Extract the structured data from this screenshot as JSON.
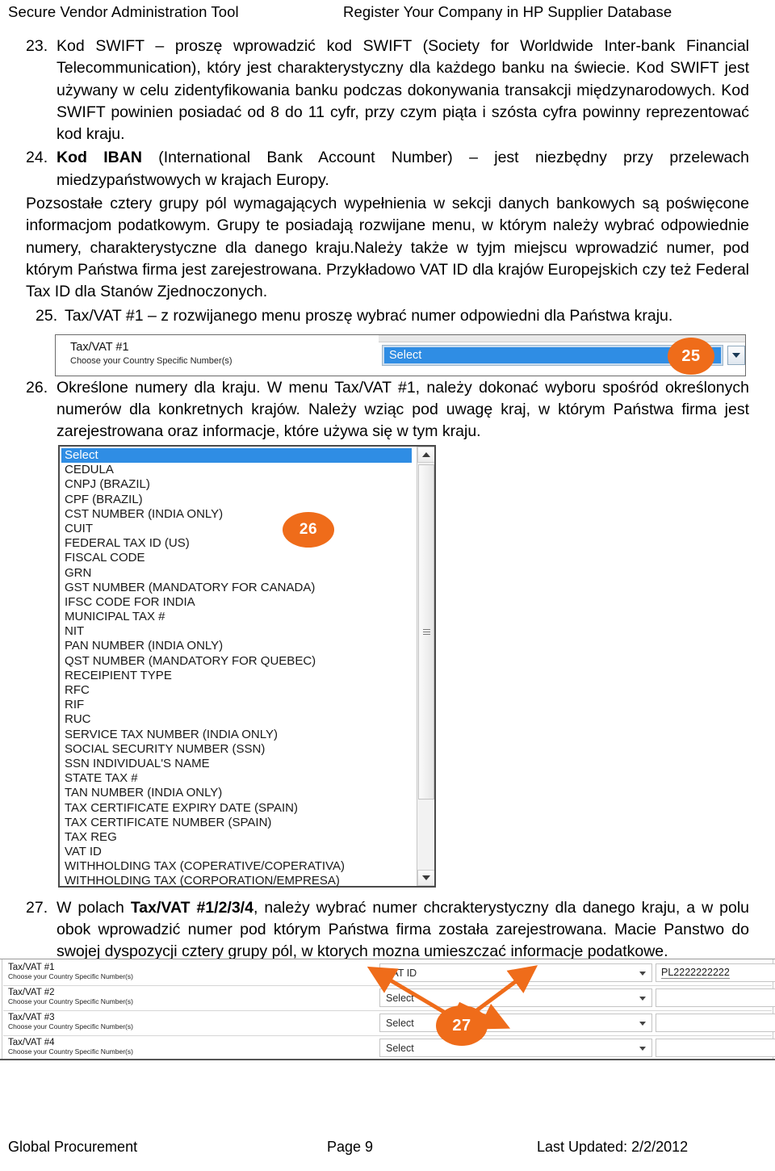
{
  "header": {
    "left": "Secure Vendor Administration Tool",
    "right": "Register Your Company in HP Supplier Database"
  },
  "items": {
    "i23": {
      "num": "23.",
      "text": "Kod SWIFT – proszę wprowadzić kod SWIFT (Society for Worldwide Inter-bank Financial Telecommunication), który jest charakterystyczny dla każdego banku na świecie. Kod SWIFT jest używany w celu zidentyfikowania banku podczas dokonywania transakcji międzynarodowych. Kod SWIFT powinien posiadać od 8 do 11 cyfr, przy czym piąta i szósta cyfra powinny reprezentować kod kraju."
    },
    "i24": {
      "num": "24.",
      "bold": "Kod IBAN",
      "text": " (International Bank Account Number) – jest niezbędny przy przelewach miedzypaństwowych w krajach Europy."
    },
    "p_after_24": "Pozsostałe cztery grupy pól wymagających wypełnienia w sekcji danych bankowych są poświęcone informacjom podatkowym. Grupy te posiadają rozwijane menu, w którym należy wybrać odpowiednie numery, charakterystyczne dla danego kraju.Należy także w tyjm miejscu wprowadzić numer, pod którym Państwa firma jest zarejestrowana. Przykładowo VAT ID dla krajów Europejskich czy też Federal Tax ID dla Stanów Zjednoczonych.",
    "i25": {
      "num": "25.",
      "text": "Tax/VAT #1 – z rozwijanego menu proszę wybrać numer odpowiedni dla Państwa kraju."
    },
    "i26": {
      "num": "26.",
      "text": "Określone numery dla kraju. W menu Tax/VAT #1, należy dokonać wyboru spośród określonych numerów dla konkretnych krajów. Należy wziąc pod uwagę kraj, w którym Państwa firma jest zarejestrowana oraz informacje, które używa się w tym kraju."
    },
    "i27": {
      "num": "27.",
      "pre": "W polach ",
      "bold": "Tax/VAT #1/2/3/4",
      "post": ", należy wybrać numer chcrakterystyczny dla danego kraju, a w polu obok wprowadzić numer pod którym Państwa firma została zarejestrowana. Macie Panstwo do swojej dyspozycji cztery grupy pól, w ktorych mozna umieszczać informacje podatkowe."
    }
  },
  "figure25": {
    "field_label": "Tax/VAT #1",
    "field_sublabel": "Choose your Country Specific Number(s)",
    "select_value": "Select",
    "badge": "25"
  },
  "figure26": {
    "badge": "26",
    "options": [
      "Select",
      "CEDULA",
      "CNPJ (BRAZIL)",
      "CPF (BRAZIL)",
      "CST NUMBER (INDIA ONLY)",
      "CUIT",
      "FEDERAL TAX ID (US)",
      "FISCAL CODE",
      "GRN",
      "GST NUMBER (MANDATORY FOR CANADA)",
      "IFSC CODE FOR INDIA",
      "MUNICIPAL TAX #",
      "NIT",
      "PAN NUMBER (INDIA ONLY)",
      "QST NUMBER (MANDATORY FOR QUEBEC)",
      "RECEIPIENT TYPE",
      "RFC",
      "RIF",
      "RUC",
      "SERVICE TAX NUMBER (INDIA ONLY)",
      "SOCIAL SECURITY NUMBER (SSN)",
      "SSN INDIVIDUAL'S NAME",
      "STATE TAX #",
      "TAN NUMBER (INDIA ONLY)",
      "TAX CERTIFICATE EXPIRY DATE (SPAIN)",
      "TAX CERTIFICATE NUMBER (SPAIN)",
      "TAX REG",
      "VAT ID",
      "WITHHOLDING TAX (COPERATIVE/COPERATIVA)",
      "WITHHOLDING TAX (CORPORATION/EMPRESA)"
    ],
    "selected_option": "Select"
  },
  "figure27": {
    "badge": "27",
    "sublabel": "Choose your Country Specific Number(s)",
    "rows": [
      {
        "label": "Tax/VAT #1",
        "select": "VAT ID",
        "value": "PL2222222222"
      },
      {
        "label": "Tax/VAT #2",
        "select": "Select",
        "value": ""
      },
      {
        "label": "Tax/VAT #3",
        "select": "Select",
        "value": ""
      },
      {
        "label": "Tax/VAT #4",
        "select": "Select",
        "value": ""
      }
    ]
  },
  "footer": {
    "left": "Global Procurement",
    "middle": "Page 9",
    "right": "Last Updated: 2/2/2012"
  },
  "colors": {
    "badge_orange": "#ef6c1a",
    "select_blue": "#2f8de4"
  }
}
